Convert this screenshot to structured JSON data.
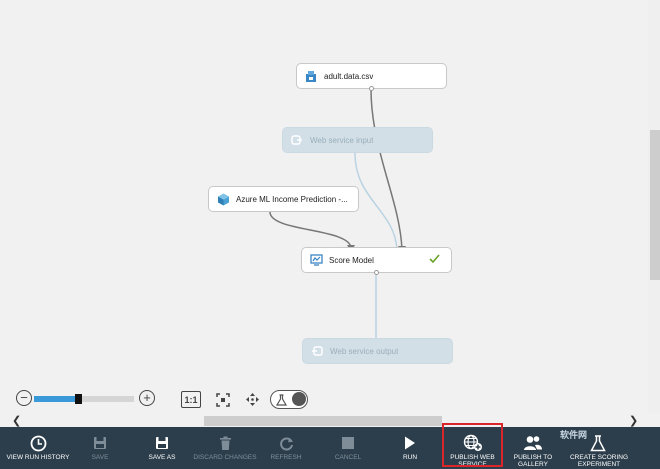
{
  "nodes": {
    "adult_data": {
      "label": "adult.data.csv"
    },
    "web_input": {
      "label": "Web service input"
    },
    "azure_model": {
      "label": "Azure ML Income Prediction -..."
    },
    "score_model": {
      "label": "Score Model",
      "status": "completed"
    },
    "web_output": {
      "label": "Web service output"
    }
  },
  "zoom": {
    "fit_label": "1:1",
    "level": 0.42
  },
  "command_bar": {
    "view_run_history": "VIEW RUN HISTORY",
    "save": "SAVE",
    "save_as": "SAVE AS",
    "discard_changes": "DISCARD CHANGES",
    "refresh": "REFRESH",
    "cancel": "CANCEL",
    "run": "RUN",
    "publish_web_service": "PUBLISH WEB\nSERVICE",
    "publish_to_gallery": "PUBLISH TO\nGALLERY",
    "create_scoring": "CREATE SCORING\nEXPERIMENT"
  },
  "watermark": "软件网",
  "colors": {
    "command_bar_bg": "#2c3e4c",
    "accent": "#3a9ad9",
    "highlight": "#d9262b",
    "ghost_node": "#d2dfe7"
  }
}
